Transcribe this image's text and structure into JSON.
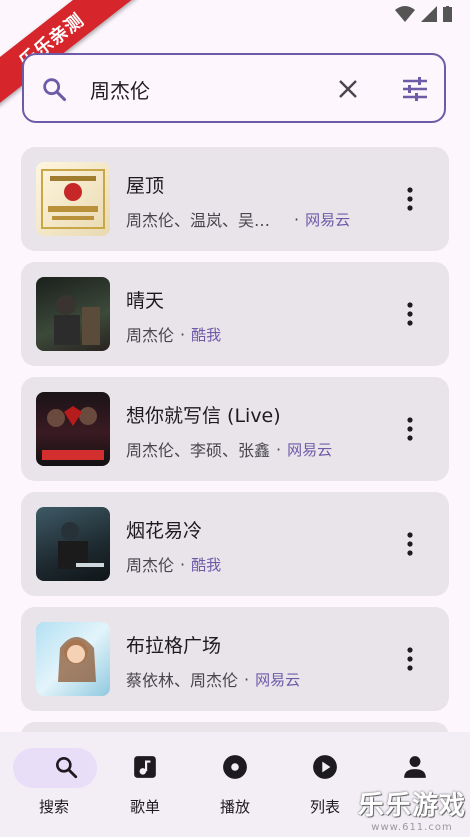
{
  "ribbon": "乐乐亲测",
  "search": {
    "query": "周杰伦"
  },
  "songs": [
    {
      "title": "屋顶",
      "artists": "周杰伦、温岚、吴…",
      "source": "网易云"
    },
    {
      "title": "晴天",
      "artists": "周杰伦",
      "source": "酷我"
    },
    {
      "title": "想你就写信 (Live)",
      "artists": "周杰伦、李硕、张鑫",
      "source": "网易云"
    },
    {
      "title": "烟花易冷",
      "artists": "周杰伦",
      "source": "酷我"
    },
    {
      "title": "布拉格广场",
      "artists": "蔡依林、周杰伦",
      "source": "网易云"
    }
  ],
  "nav": {
    "search": "搜索",
    "playlists": "歌单",
    "play": "播放",
    "list": "列表",
    "profile": "我的"
  },
  "watermark": {
    "brand": "乐乐游戏",
    "site": "www.611.com"
  },
  "colors": {
    "accent": "#6e5ba8",
    "ribbon": "#d6262c",
    "card": "#e8e4ea"
  }
}
